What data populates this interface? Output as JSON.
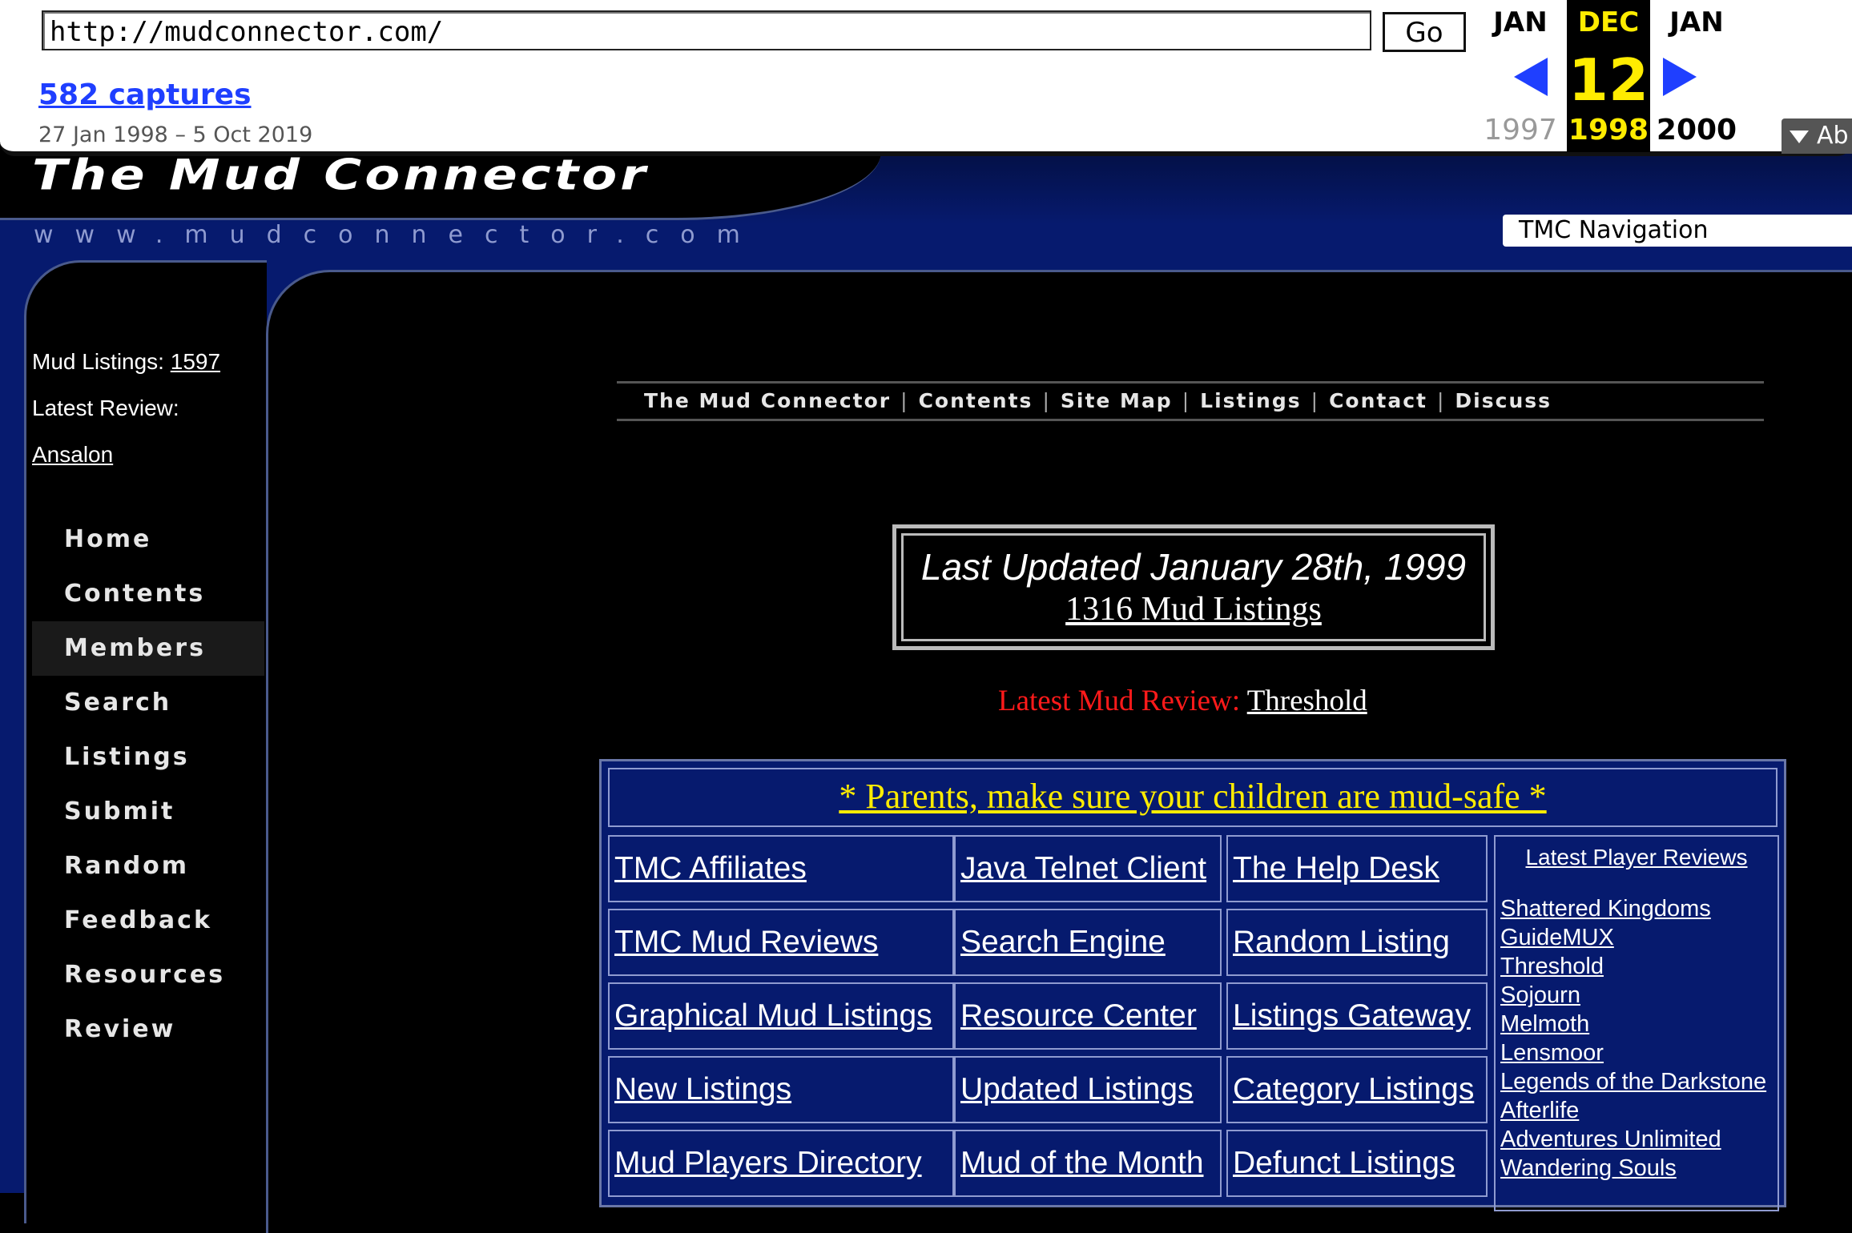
{
  "wayback": {
    "url": "http://mudconnector.com/",
    "go_label": "Go",
    "captures": "582 captures",
    "date_range": "27 Jan 1998 – 5 Oct 2019",
    "prev": {
      "month": "JAN",
      "year": "1997"
    },
    "current": {
      "month": "DEC",
      "day": "12",
      "year": "1998"
    },
    "next": {
      "month": "JAN",
      "year": "2000"
    },
    "about_label": "Ab"
  },
  "site": {
    "title": "The Mud Connector",
    "url_text": "www.mudconnector.com",
    "nav_select": "TMC Navigation"
  },
  "sidebar": {
    "mud_listings_label": "Mud Listings:",
    "mud_listings_count": "1597",
    "latest_review_label": "Latest Review:",
    "latest_review_link": "Ansalon",
    "nav": [
      {
        "label": "Home"
      },
      {
        "label": "Contents"
      },
      {
        "label": "Members"
      },
      {
        "label": "Search"
      },
      {
        "label": "Listings"
      },
      {
        "label": "Submit"
      },
      {
        "label": "Random"
      },
      {
        "label": "Feedback"
      },
      {
        "label": "Resources"
      },
      {
        "label": "Review"
      }
    ]
  },
  "topnav": [
    "The Mud Connector",
    "Contents",
    "Site Map",
    "Listings",
    "Contact",
    "Discuss"
  ],
  "updated": {
    "line1": "Last Updated January 28th, 1999",
    "line2": "1316 Mud Listings"
  },
  "latest_mud_review": {
    "label": "Latest Mud Review:",
    "link": "Threshold"
  },
  "table": {
    "banner": "* Parents, make sure your children are mud-safe *",
    "links": [
      [
        "TMC Affiliates",
        "Java Telnet Client",
        "The Help Desk"
      ],
      [
        "TMC Mud Reviews",
        "Search Engine",
        "Random Listing"
      ],
      [
        "Graphical Mud Listings",
        "Resource Center",
        "Listings Gateway"
      ],
      [
        "New Listings",
        "Updated Listings",
        "Category Listings"
      ],
      [
        "Mud Players Directory",
        "Mud of the Month",
        "Defunct Listings"
      ]
    ],
    "player_reviews_title": "Latest Player Reviews",
    "player_reviews": [
      "Shattered Kingdoms",
      "GuideMUX",
      "Threshold",
      "Sojourn",
      "Melmoth",
      "Lensmoor",
      "Legends of the Darkstone",
      "Afterlife",
      "Adventures Unlimited",
      "Wandering Souls"
    ]
  }
}
